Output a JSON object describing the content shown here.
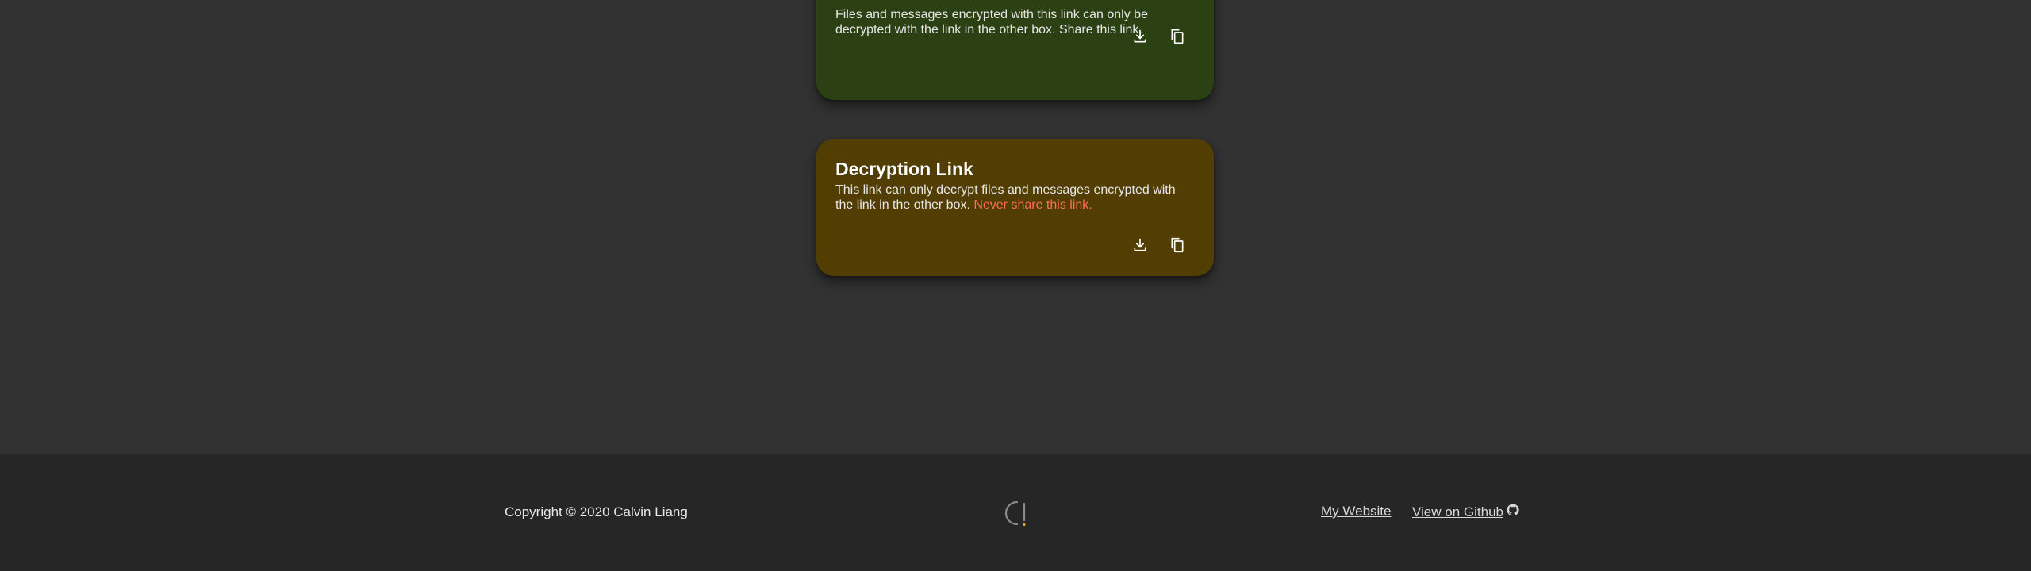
{
  "encryption_card": {
    "description": "Files and messages encrypted with this link can only be decrypted with the link in the other box. Share this link.",
    "download_icon": "download-icon",
    "copy_icon": "copy-icon"
  },
  "decryption_card": {
    "title": "Decryption Link",
    "description_prefix": "This link can only decrypt files and messages encrypted with the link in the other box. ",
    "warning": "Never share this link.",
    "download_icon": "download-icon",
    "copy_icon": "copy-icon"
  },
  "footer": {
    "copyright": "Copyright © 2020 Calvin Liang",
    "logo_icon": "logo-icon",
    "links": {
      "website": "My Website",
      "github": "View on Github"
    },
    "github_icon": "github-icon"
  },
  "colors": {
    "page_background": "#323232",
    "footer_background": "#262626",
    "encryption_card": "#2c4113",
    "decryption_card": "#523d03",
    "warning_text": "#ff6e57"
  }
}
